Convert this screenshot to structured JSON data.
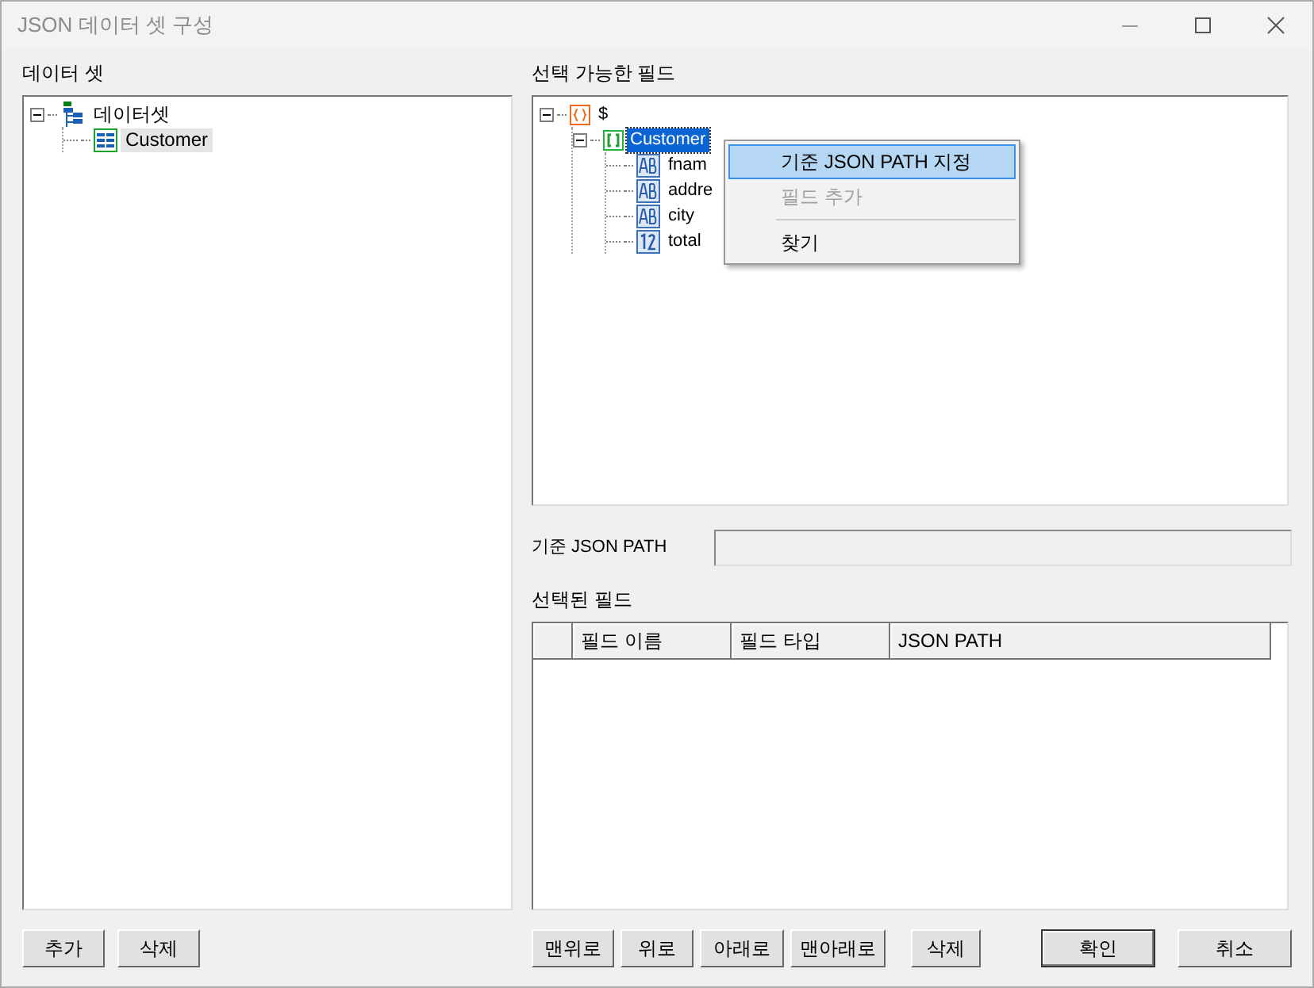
{
  "window": {
    "title": "JSON 데이터 셋 구성"
  },
  "dataset_panel": {
    "label": "데이터 셋",
    "tree": [
      {
        "label": "데이터셋",
        "kind": "dataset",
        "expanded": true,
        "selected": false,
        "children": [
          {
            "label": "Customer",
            "kind": "table",
            "selected": true
          }
        ]
      }
    ],
    "buttons": [
      "추가",
      "삭제"
    ]
  },
  "fields_panel": {
    "label": "선택 가능한 필드",
    "tree": [
      {
        "label": "$",
        "kind": "object",
        "expanded": true,
        "selected": false,
        "children": [
          {
            "label": "Customer",
            "kind": "array",
            "expanded": true,
            "selected": true,
            "children": [
              {
                "label": "fnam",
                "kind": "string",
                "selected": false
              },
              {
                "label": "addre",
                "kind": "string",
                "selected": false
              },
              {
                "label": "city",
                "kind": "string",
                "selected": false
              },
              {
                "label": "total",
                "kind": "number",
                "selected": false
              }
            ]
          }
        ]
      }
    ]
  },
  "context_menu": [
    {
      "label": "기준 JSON PATH 지정",
      "selected": true,
      "disabled": false
    },
    {
      "label": "필드 추가",
      "selected": false,
      "disabled": true
    },
    {
      "kind": "separator"
    },
    {
      "label": "찾기",
      "selected": false,
      "disabled": false
    }
  ],
  "base_path": {
    "label": "기준 JSON PATH"
  },
  "selected_fields": {
    "label": "선택된 필드",
    "columns": [
      "필드 이름",
      "필드 타입",
      "JSON PATH"
    ],
    "buttons": [
      "맨위로",
      "위로",
      "아래로",
      "맨아래로",
      "삭제"
    ]
  },
  "dialog_buttons": [
    {
      "label": "확인",
      "default": true
    },
    {
      "label": "취소",
      "default": false
    }
  ]
}
